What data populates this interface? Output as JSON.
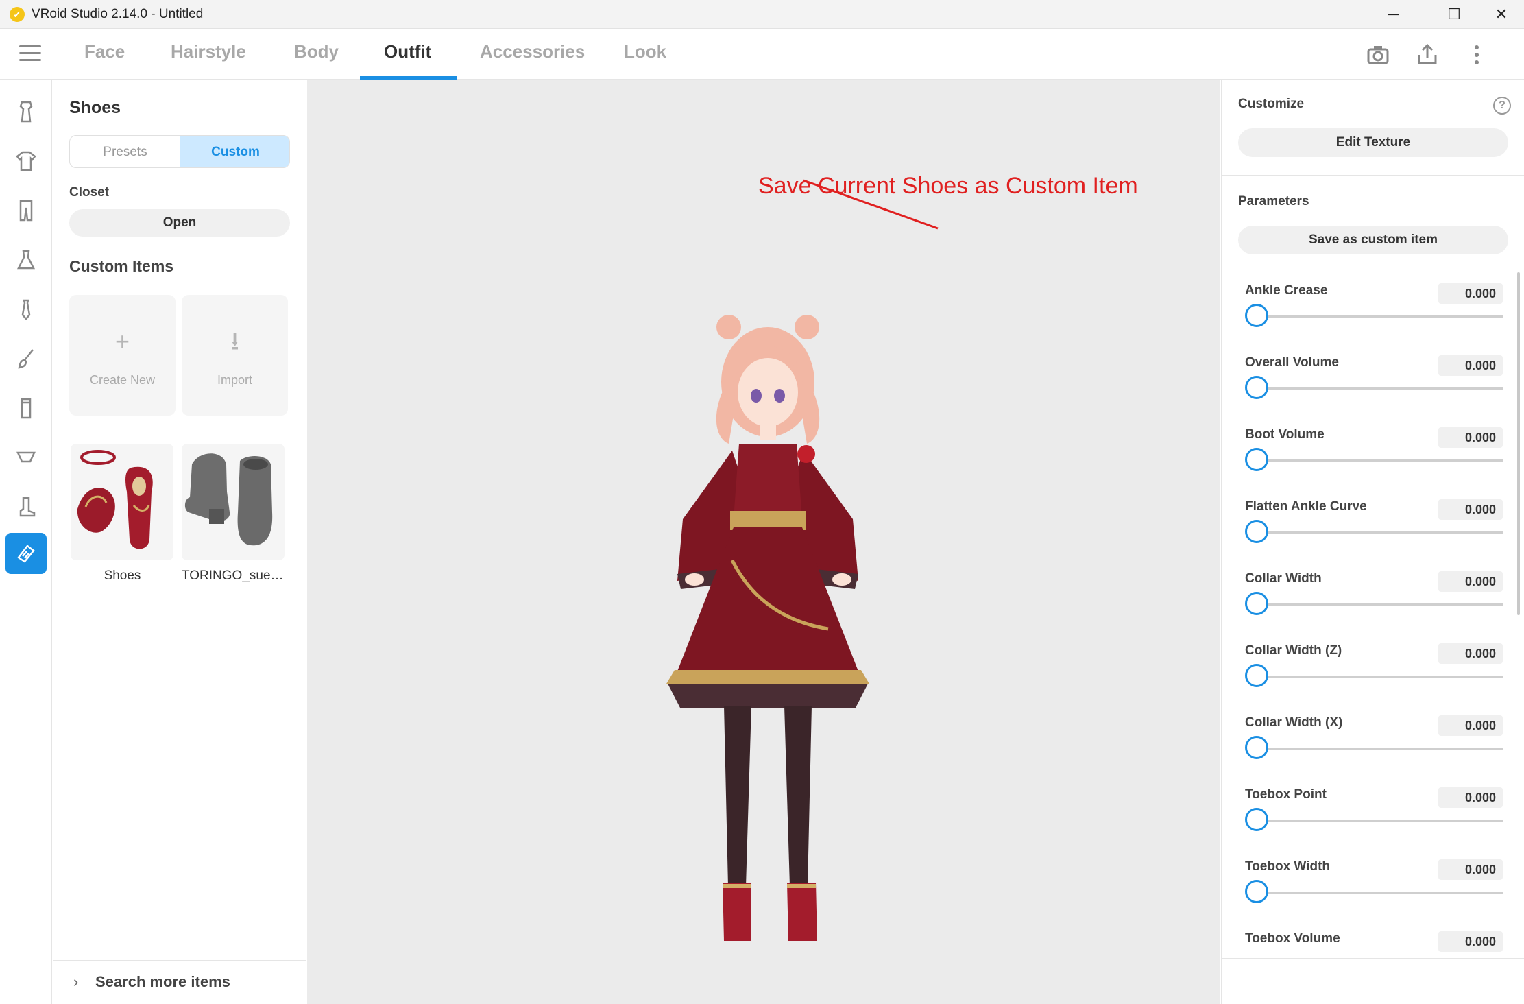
{
  "window": {
    "title": "VRoid Studio 2.14.0 - Untitled",
    "logo_glyph": "✓",
    "minimize_glyph": "─",
    "maximize_glyph": "☐",
    "close_glyph": "✕"
  },
  "tabs": [
    {
      "label": "Face"
    },
    {
      "label": "Hairstyle"
    },
    {
      "label": "Body"
    },
    {
      "label": "Outfit",
      "active": true
    },
    {
      "label": "Accessories"
    },
    {
      "label": "Look"
    }
  ],
  "toolbar_icons": [
    "camera-icon",
    "export-icon",
    "more-vertical-icon"
  ],
  "rail_icons": [
    "onepiece-icon",
    "tops-icon",
    "bottoms-icon",
    "dress-icon",
    "tie-icon",
    "brush-icon",
    "socks-icon",
    "underwear-icon",
    "boot-icon",
    "shoes-icon"
  ],
  "left_panel": {
    "title": "Shoes",
    "segment": {
      "presets": "Presets",
      "custom": "Custom"
    },
    "closet_label": "Closet",
    "open_button": "Open",
    "custom_items_title": "Custom Items",
    "create_new": {
      "glyph": "+",
      "label": "Create New"
    },
    "import": {
      "glyph": "⭳",
      "label": "Import"
    },
    "items": [
      {
        "name": "Shoes"
      },
      {
        "name": "TORINGO_sued…"
      }
    ],
    "search_more": {
      "chevron": "›",
      "label": "Search more items"
    }
  },
  "annotation": {
    "text": "Save Current Shoes as Custom Item",
    "color": "#e02020"
  },
  "right_panel": {
    "customize_title": "Customize",
    "help_glyph": "?",
    "edit_texture_button": "Edit Texture",
    "parameters_title": "Parameters",
    "save_custom_button": "Save as custom item",
    "params": [
      {
        "label": "Ankle Crease",
        "value": "0.000"
      },
      {
        "label": "Overall Volume",
        "value": "0.000"
      },
      {
        "label": "Boot Volume",
        "value": "0.000"
      },
      {
        "label": "Flatten Ankle Curve",
        "value": "0.000"
      },
      {
        "label": "Collar Width",
        "value": "0.000"
      },
      {
        "label": "Collar Width (Z)",
        "value": "0.000"
      },
      {
        "label": "Collar Width (X)",
        "value": "0.000"
      },
      {
        "label": "Toebox Point",
        "value": "0.000"
      },
      {
        "label": "Toebox Width",
        "value": "0.000"
      },
      {
        "label": "Toebox Volume",
        "value": "0.000"
      }
    ]
  },
  "colors": {
    "accent": "#1a8fe3",
    "segment_active_bg": "#cde9ff"
  }
}
